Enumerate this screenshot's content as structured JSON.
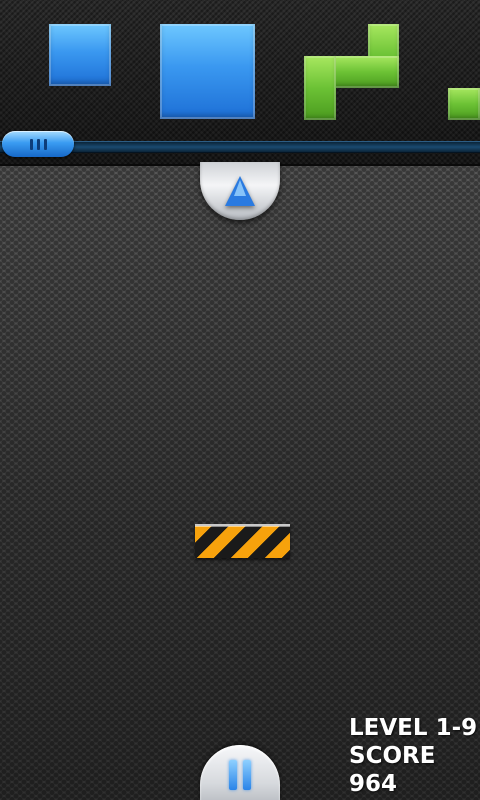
{
  "hud": {
    "level_label": "LEVEL",
    "level": "1-9",
    "score_label": "SCORE",
    "score": "964"
  },
  "tray": {
    "pieces": [
      "blue-square-small",
      "blue-square-large",
      "green-s-tetromino",
      "green-partial-piece"
    ],
    "slider_position": 0
  },
  "icons": {
    "launcher": "up-arrow-icon",
    "pause": "pause-icon"
  },
  "colors": {
    "blue_block": "#3a98f0",
    "green_block": "#6cc235",
    "hazard_orange": "#f7a20c",
    "slider_blue": "#3a9cf2"
  }
}
